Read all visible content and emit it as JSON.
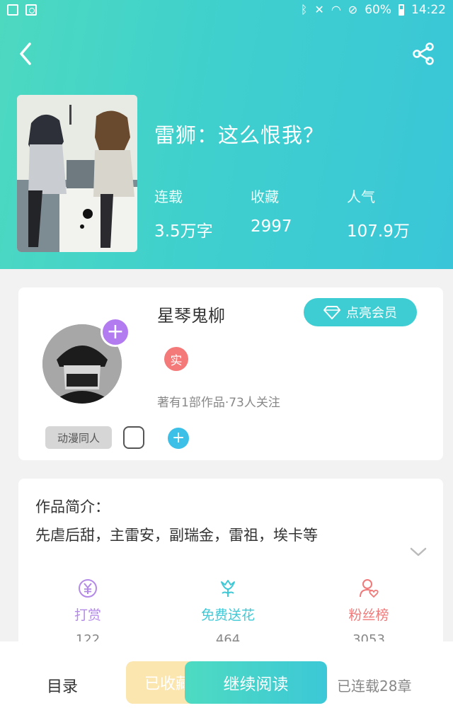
{
  "status_bar": {
    "battery": "60%",
    "time": "14:22"
  },
  "book": {
    "title": "雷狮：这么恨我？",
    "stats": [
      {
        "label": "连载",
        "value": "3.5万字"
      },
      {
        "label": "收藏",
        "value": "2997"
      },
      {
        "label": "人气",
        "value": "107.9万"
      }
    ]
  },
  "author": {
    "name": "星琴鬼柳",
    "vip_label": "点亮会员",
    "badge": "实",
    "meta": "著有1部作品·73人关注",
    "tag": "动漫同人"
  },
  "intro": {
    "heading": "作品简介：",
    "text": "先虐后甜，主雷安，副瑞金，雷祖，埃卡等"
  },
  "actions": [
    {
      "label": "打赏",
      "count": "122",
      "icon": "yen-coin-icon",
      "color": "#b48ae8"
    },
    {
      "label": "免费送花",
      "count": "464",
      "icon": "flower-icon",
      "color": "#3fc9d6"
    },
    {
      "label": "粉丝榜",
      "count": "3053",
      "icon": "fan-ranking-icon",
      "color": "#f07a7a"
    }
  ],
  "bottom_bar": {
    "toc": "目录",
    "collected": "已收藏",
    "continue": "继续阅读",
    "chapter_status": "已连载28章"
  }
}
